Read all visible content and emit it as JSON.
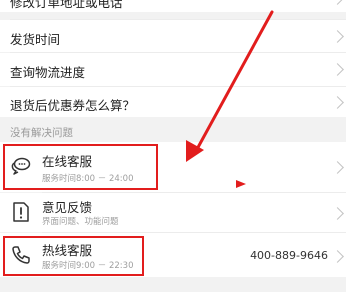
{
  "faq": {
    "items": [
      {
        "label": "修改订单地址或电话"
      },
      {
        "label": "发货时间"
      },
      {
        "label": "查询物流进度"
      },
      {
        "label": "退货后优惠券怎么算？"
      }
    ]
  },
  "section": {
    "title": "没有解决问题"
  },
  "services": {
    "online": {
      "title": "在线客服",
      "hours": "服务时间8:00 － 24:00",
      "icon": "chat-bubble-icon"
    },
    "feedback": {
      "title": "意见反馈",
      "desc": "界面问题、功能问题",
      "icon": "feedback-doc-icon"
    },
    "hotline": {
      "title": "热线客服",
      "hours": "服务时间9:00 － 22:30",
      "phone": "400-889-9646",
      "icon": "phone-icon"
    }
  },
  "colors": {
    "annotation_red": "#e21d1d",
    "background": "#f2f2f2"
  }
}
